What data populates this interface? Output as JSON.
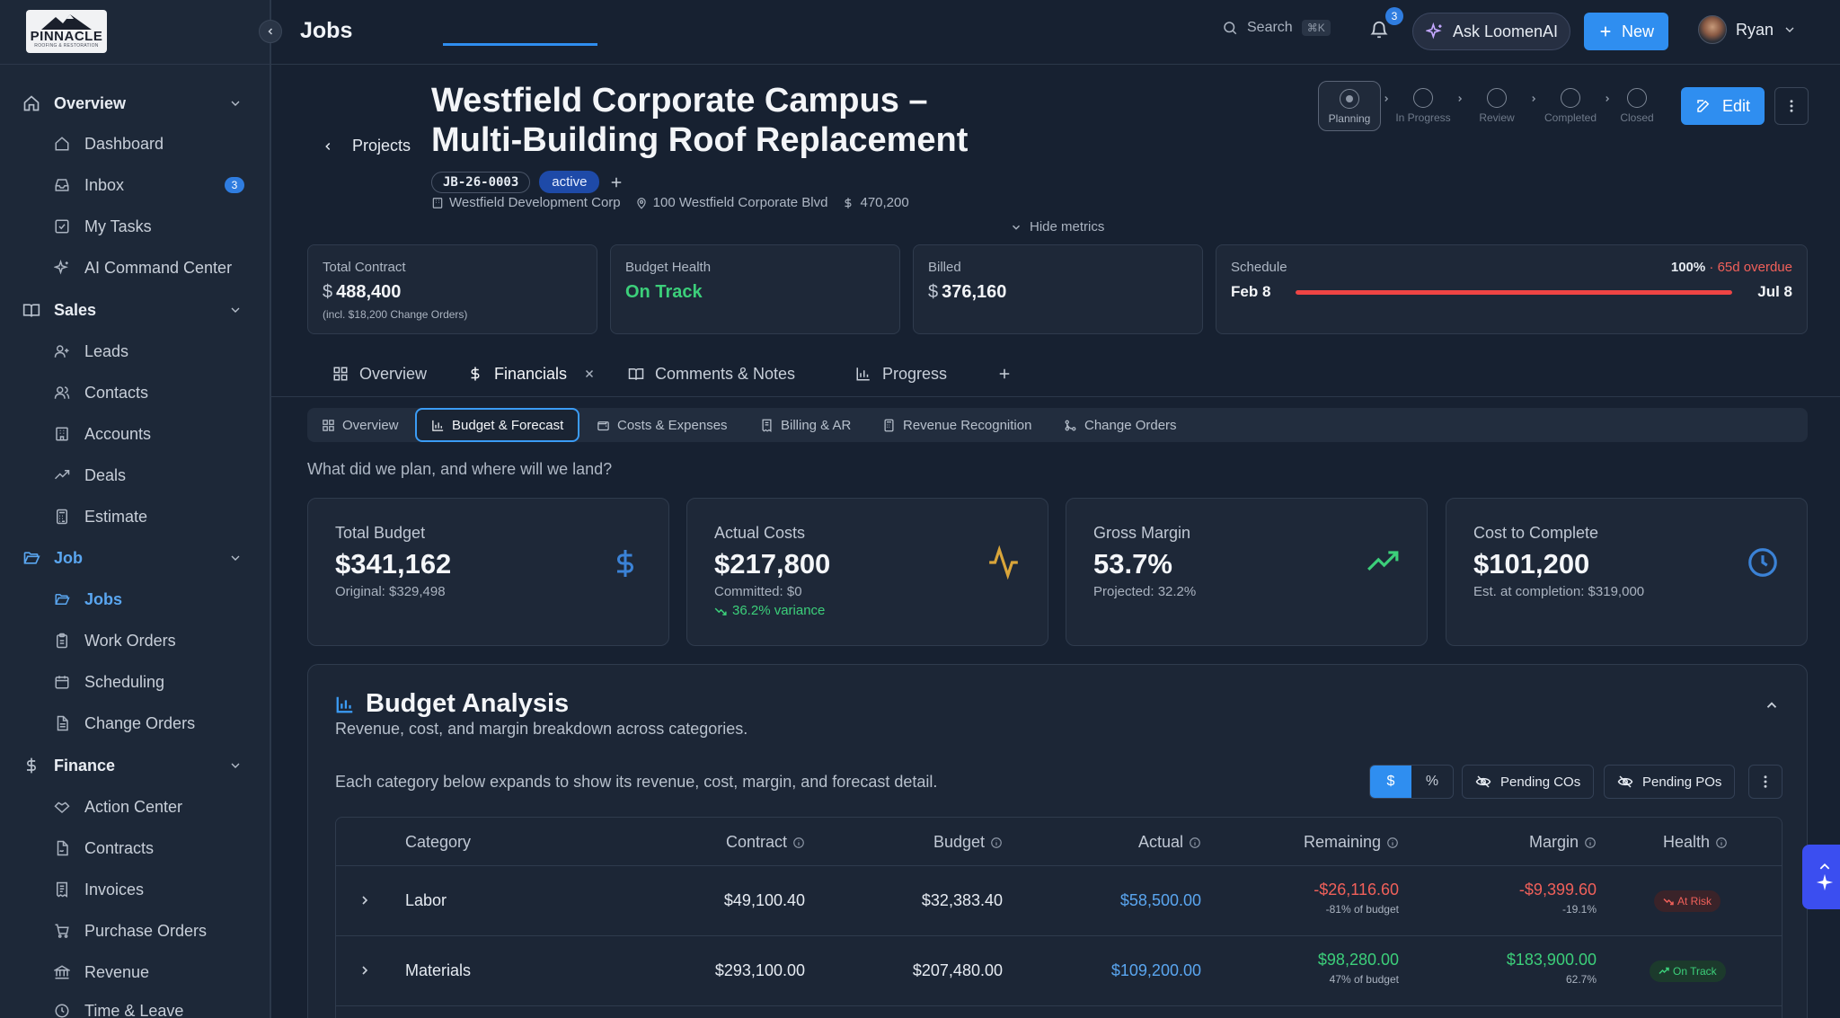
{
  "sidebar": {
    "logo": {
      "brand": "PINNACLE",
      "tagline": "ROOFING & RESTORATION"
    },
    "groups": [
      {
        "label": "Overview",
        "items": [
          {
            "label": "Dashboard"
          },
          {
            "label": "Inbox",
            "badge": "3"
          },
          {
            "label": "My Tasks"
          },
          {
            "label": "AI Command Center"
          }
        ]
      },
      {
        "label": "Sales",
        "items": [
          {
            "label": "Leads"
          },
          {
            "label": "Contacts"
          },
          {
            "label": "Accounts"
          },
          {
            "label": "Deals"
          },
          {
            "label": "Estimate"
          }
        ]
      },
      {
        "label": "Job",
        "items": [
          {
            "label": "Jobs"
          },
          {
            "label": "Work Orders"
          },
          {
            "label": "Scheduling"
          },
          {
            "label": "Change Orders"
          }
        ]
      },
      {
        "label": "Finance",
        "items": [
          {
            "label": "Action Center"
          },
          {
            "label": "Contracts"
          },
          {
            "label": "Invoices"
          },
          {
            "label": "Purchase Orders"
          },
          {
            "label": "Revenue"
          },
          {
            "label": "Time & Leave"
          }
        ]
      }
    ]
  },
  "topbar": {
    "title": "Jobs",
    "search_label": "Search",
    "search_shortcut": "⌘K",
    "notifications_count": "3",
    "ask_label": "Ask LoomenAI",
    "new_label": "New",
    "user_name": "Ryan"
  },
  "header": {
    "back_label": "Projects",
    "title": "Westfield Corporate Campus – Multi-Building Roof Replacement",
    "job_id": "JB-26-0003",
    "status": "active",
    "company": "Westfield Development Corp",
    "address": "100 Westfield Corporate Blvd",
    "amount": "470,200",
    "stages": [
      "Planning",
      "In Progress",
      "Review",
      "Completed",
      "Closed"
    ],
    "edit_label": "Edit",
    "hide_metrics_label": "Hide metrics"
  },
  "metrics": {
    "total_contract": {
      "label": "Total Contract",
      "currency": "$",
      "value": "488,400",
      "sub": "(incl. $18,200 Change Orders)"
    },
    "budget_health": {
      "label": "Budget Health",
      "value": "On Track"
    },
    "billed": {
      "label": "Billed",
      "currency": "$",
      "value": "376,160"
    },
    "schedule": {
      "label": "Schedule",
      "percent": "100%",
      "separator": "·",
      "overdue": "65d overdue",
      "start": "Feb 8",
      "end": "Jul 8",
      "progress": 1.0
    }
  },
  "tabs": [
    {
      "label": "Overview"
    },
    {
      "label": "Financials"
    },
    {
      "label": "Comments & Notes"
    },
    {
      "label": "Progress"
    }
  ],
  "subtabs": [
    {
      "label": "Overview"
    },
    {
      "label": "Budget & Forecast"
    },
    {
      "label": "Costs & Expenses"
    },
    {
      "label": "Billing & AR"
    },
    {
      "label": "Revenue Recognition"
    },
    {
      "label": "Change Orders"
    }
  ],
  "question": "What did we plan, and where will we land?",
  "kpis": {
    "total_budget": {
      "label": "Total Budget",
      "value": "$341,162",
      "sub": "Original: $329,498"
    },
    "actual_costs": {
      "label": "Actual Costs",
      "value": "$217,800",
      "sub": "Committed: $0",
      "variance": "36.2% variance"
    },
    "gross_margin": {
      "label": "Gross Margin",
      "value": "53.7%",
      "sub": "Projected: 32.2%"
    },
    "cost_to_complete": {
      "label": "Cost to Complete",
      "value": "$101,200",
      "sub": "Est. at completion: $319,000"
    }
  },
  "analysis": {
    "title": "Budget Analysis",
    "subtitle": "Revenue, cost, and margin breakdown across categories.",
    "description": "Each category below expands to show its revenue, cost, margin, and forecast detail.",
    "toggle_dollar": "$",
    "toggle_percent": "%",
    "pending_cos": "Pending COs",
    "pending_pos": "Pending POs",
    "columns": [
      "Category",
      "Contract",
      "Budget",
      "Actual",
      "Remaining",
      "Margin",
      "Health"
    ],
    "rows": [
      {
        "category": "Labor",
        "contract": "$49,100.40",
        "budget": "$32,383.40",
        "actual": "$58,500.00",
        "remaining": "-$26,116.60",
        "remaining_pct": "-81% of budget",
        "margin": "-$9,399.60",
        "margin_pct": "-19.1%",
        "health": "At Risk"
      },
      {
        "category": "Materials",
        "contract": "$293,100.00",
        "budget": "$207,480.00",
        "actual": "$109,200.00",
        "remaining": "$98,280.00",
        "remaining_pct": "47% of budget",
        "margin": "$183,900.00",
        "margin_pct": "62.7%",
        "health": "On Track"
      }
    ]
  },
  "colors": {
    "accent": "#2f8ef0",
    "positive": "#3ccf7a",
    "negative": "#f0605a",
    "background": "#172131"
  }
}
